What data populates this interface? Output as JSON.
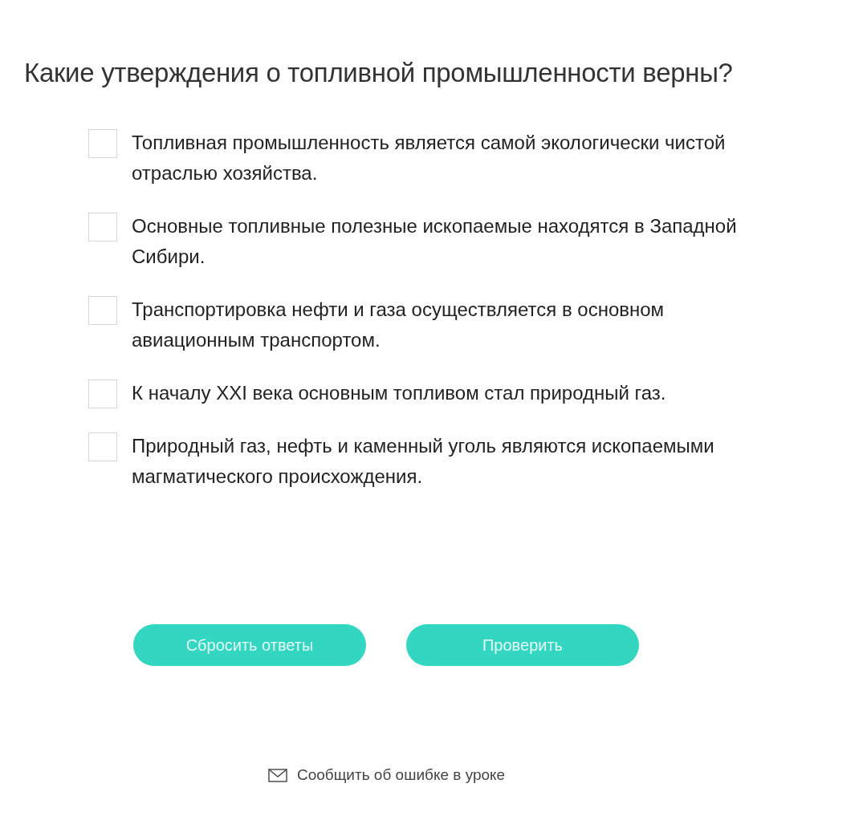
{
  "question": "Какие утверждения о топливной промышленности верны?",
  "options": [
    {
      "text": "Топливная промышленность является самой экологически чистой отраслью хозяйства.",
      "checked": false
    },
    {
      "text": "Основные топливные полезные ископаемые находятся в Западной Сибири.",
      "checked": false
    },
    {
      "text": "Транспортировка нефти и газа осуществляется в основном авиационным транспортом.",
      "checked": false
    },
    {
      "text": "К началу XXI века основным топливом стал природный газ.",
      "checked": false
    },
    {
      "text": "Природный газ, нефть и каменный уголь являются ископаемыми магматического происхождения.",
      "checked": false
    }
  ],
  "buttons": [
    "Сбросить ответы",
    "Проверить"
  ],
  "report_link": "Сообщить об ошибке в уроке"
}
